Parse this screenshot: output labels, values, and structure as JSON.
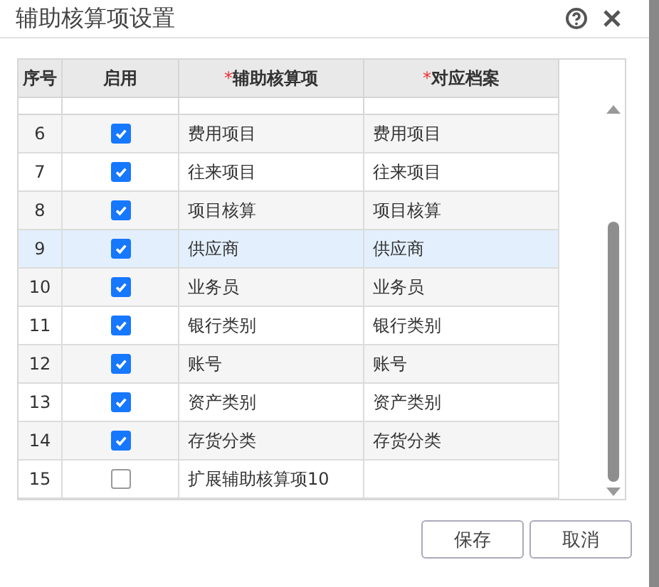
{
  "window": {
    "title": "辅助核算项设置"
  },
  "table": {
    "columns": [
      {
        "label": "序号"
      },
      {
        "label": "启用"
      },
      {
        "label": "辅助核算项",
        "required_mark": "*"
      },
      {
        "label": "对应档案",
        "required_mark": "*"
      }
    ],
    "rows": [
      {
        "no": "6",
        "enabled": true,
        "item": "费用项目",
        "archive": "费用项目",
        "selected": false
      },
      {
        "no": "7",
        "enabled": true,
        "item": "往来项目",
        "archive": "往来项目",
        "selected": false
      },
      {
        "no": "8",
        "enabled": true,
        "item": "项目核算",
        "archive": "项目核算",
        "selected": false
      },
      {
        "no": "9",
        "enabled": true,
        "item": "供应商",
        "archive": "供应商",
        "selected": true
      },
      {
        "no": "10",
        "enabled": true,
        "item": "业务员",
        "archive": "业务员",
        "selected": false
      },
      {
        "no": "11",
        "enabled": true,
        "item": "银行类别",
        "archive": "银行类别",
        "selected": false
      },
      {
        "no": "12",
        "enabled": true,
        "item": "账号",
        "archive": "账号",
        "selected": false
      },
      {
        "no": "13",
        "enabled": true,
        "item": "资产类别",
        "archive": "资产类别",
        "selected": false
      },
      {
        "no": "14",
        "enabled": true,
        "item": "存货分类",
        "archive": "存货分类",
        "selected": false
      },
      {
        "no": "15",
        "enabled": false,
        "item": "扩展辅助核算项10",
        "selected": false
      }
    ]
  },
  "buttons": [
    "保存",
    "取消"
  ]
}
